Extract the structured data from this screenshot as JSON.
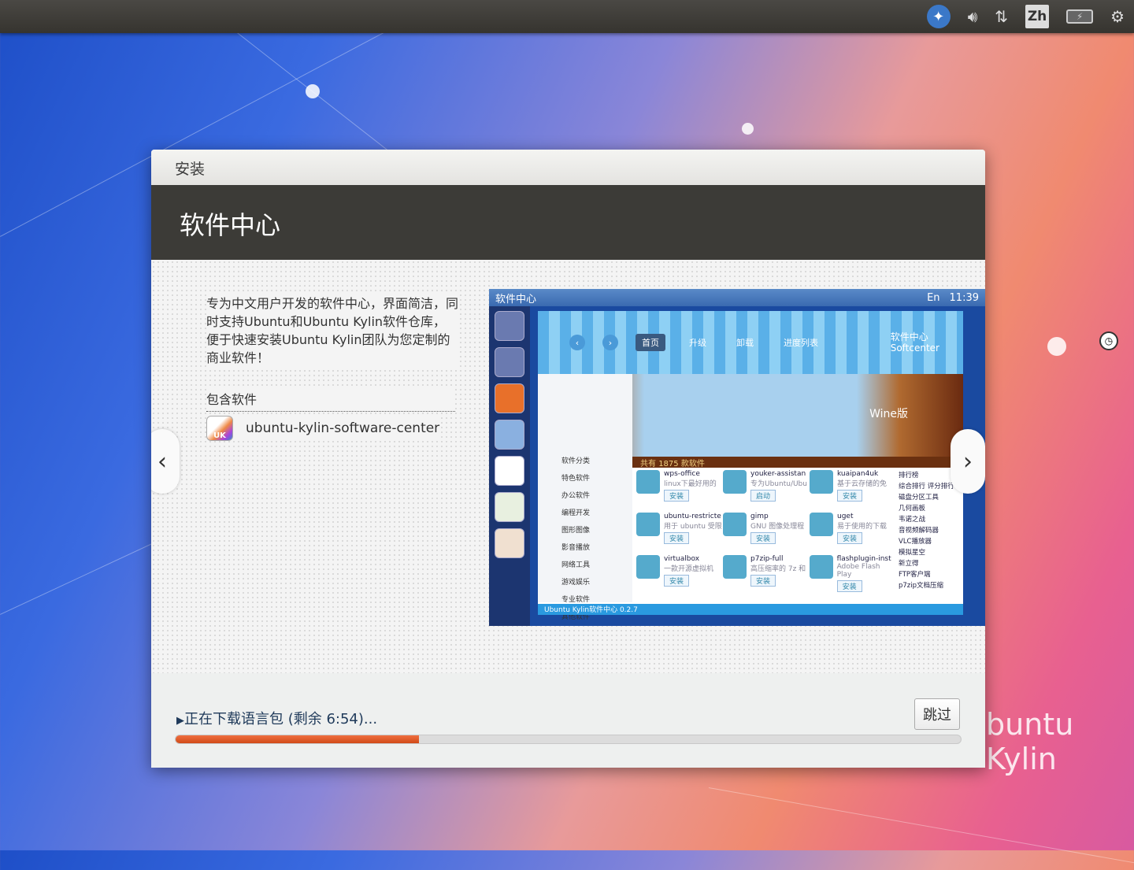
{
  "topbar": {
    "icons": [
      "accessibility-icon",
      "volume-icon",
      "network-icon",
      "input-method-icon",
      "battery-icon",
      "power-gear-icon"
    ],
    "input_method": "Zh"
  },
  "window": {
    "title": "安装",
    "header": "软件中心",
    "description": "专为中文用户开发的软件中心，界面简洁，同时支持Ubuntu和Ubuntu Kylin软件仓库，便于快速安装Ubuntu Kylin团队为您定制的商业软件！",
    "included_label": "包含软件",
    "package": "ubuntu-kylin-software-center",
    "prev": "‹",
    "next": "›",
    "status": "正在下载语言包 (剩余 6:54)...",
    "skip": "跳过",
    "progress": 0.31
  },
  "slide": {
    "topbar_title": "软件中心",
    "clock": "11:39",
    "lang": "En",
    "tabs": [
      "首页",
      "升级",
      "卸载",
      "进度列表"
    ],
    "brand_cn": "软件中心",
    "brand_en": "Softcenter",
    "wine": "Wine版",
    "count_label": "共有",
    "count": "1875",
    "count_suffix": "款软件",
    "cat_title": "软件分类",
    "categories": [
      "特色软件",
      "办公软件",
      "编程开发",
      "图形图像",
      "影音播放",
      "网络工具",
      "游戏娱乐",
      "专业软件",
      "其他软件"
    ],
    "apps": [
      {
        "name": "wps-office",
        "desc": "linux下最好用的",
        "btn": "安装"
      },
      {
        "name": "youker-assistan",
        "desc": "专为Ubuntu/Ubu",
        "btn": "启动"
      },
      {
        "name": "kuaipan4uk",
        "desc": "基于云存储的免",
        "btn": "安装"
      },
      {
        "name": "ubuntu-restricte",
        "desc": "用于 ubuntu 受限",
        "btn": "安装"
      },
      {
        "name": "gimp",
        "desc": "GNU 图像处理程",
        "btn": "安装"
      },
      {
        "name": "uget",
        "desc": "易于使用的下载",
        "btn": "安装"
      },
      {
        "name": "virtualbox",
        "desc": "一款开源虚拟机",
        "btn": "安装"
      },
      {
        "name": "p7zip-full",
        "desc": "高压缩率的 7z 和",
        "btn": "安装"
      },
      {
        "name": "flashplugin-inst",
        "desc": "Adobe Flash Play",
        "btn": "安装"
      }
    ],
    "rank_title": "排行榜",
    "rank_tabs": [
      "综合排行",
      "评分排行"
    ],
    "rank": [
      "磁盘分区工具",
      "几何画板",
      "韦诺之战",
      "音视频解码器",
      "VLC播放器",
      "模拟星空",
      "新立得",
      "FTP客户端",
      "p7zip文档压缩"
    ],
    "footer": "Ubuntu Kylin软件中心 0.2.7"
  },
  "desktop": {
    "watermark": "buntu Kylin"
  },
  "colors": {
    "accent": "#e05a24",
    "header": "#3c3b37"
  }
}
